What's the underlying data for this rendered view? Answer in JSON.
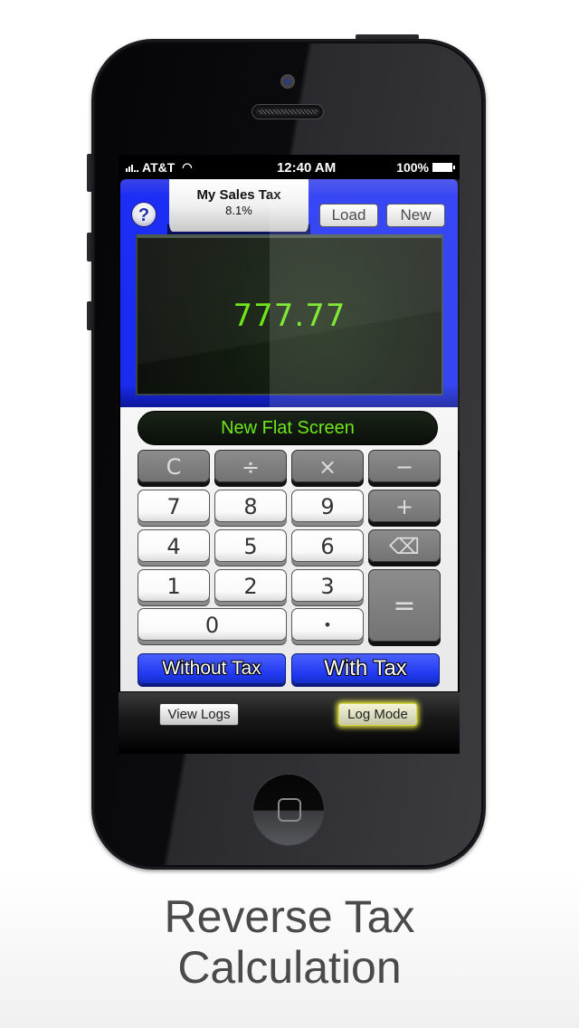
{
  "status_bar": {
    "carrier": "AT&T",
    "time": "12:40 AM",
    "battery": "100%",
    "wifi_icon": "wifi-icon",
    "signal_icon": "signal-bars-icon",
    "battery_icon": "battery-charging-icon"
  },
  "header": {
    "help_label": "?",
    "tax_profile": {
      "name": "My Sales Tax",
      "rate": "8.1%"
    },
    "load_label": "Load",
    "new_label": "New"
  },
  "display": {
    "value": "777.77",
    "item_label": "New Flat Screen"
  },
  "keypad": {
    "keys": {
      "clear": "C",
      "divide": "÷",
      "multiply": "×",
      "minus": "−",
      "plus": "+",
      "backspace": "⌫",
      "equals": "=",
      "decimal": "•",
      "d0": "0",
      "d1": "1",
      "d2": "2",
      "d3": "3",
      "d4": "4",
      "d5": "5",
      "d6": "6",
      "d7": "7",
      "d8": "8",
      "d9": "9"
    }
  },
  "mode_buttons": {
    "without_tax": "Without Tax",
    "with_tax": "With Tax"
  },
  "bottom_bar": {
    "view_logs": "View Logs",
    "log_mode": "Log Mode"
  },
  "caption": {
    "line1": "Reverse Tax",
    "line2": "Calculation"
  }
}
